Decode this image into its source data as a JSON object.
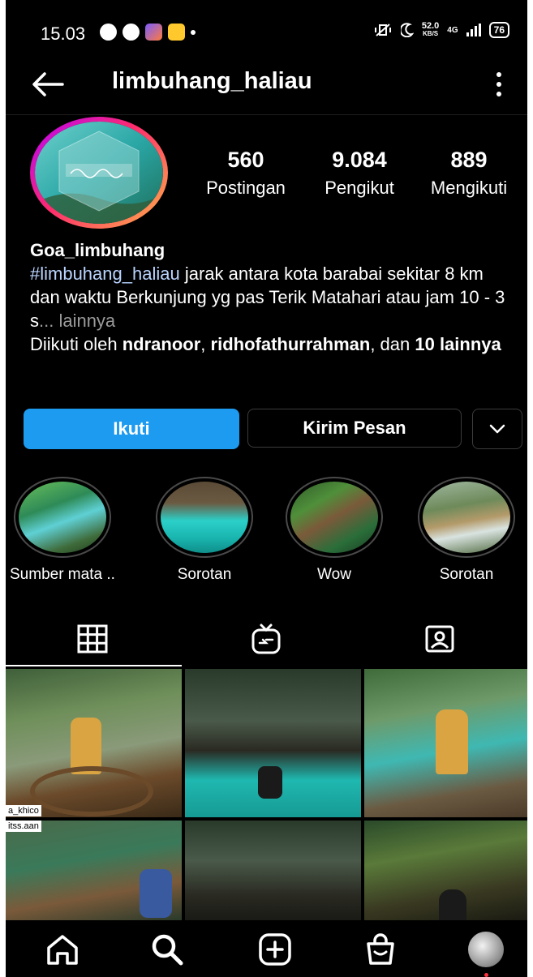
{
  "status_bar": {
    "time": "15.03",
    "network_speed": "52.0",
    "network_unit": "KB/S",
    "network_type": "4G",
    "battery": "76"
  },
  "header": {
    "username": "limbuhang_haliau"
  },
  "profile": {
    "avatar_icon": "profile-logo",
    "stats": [
      {
        "value": "560",
        "label": "Postingan"
      },
      {
        "value": "9.084",
        "label": "Pengikut"
      },
      {
        "value": "889",
        "label": "Mengikuti"
      }
    ],
    "bio": {
      "name": "Goa_limbuhang",
      "hashtag": "#limbuhang_haliau",
      "text": " jarak antara kota barabai sekitar 8 km dan waktu Berkunjung yg pas Terik Matahari atau jam 10 - 3 s",
      "more_label": "... lainnya",
      "followed_by_prefix": "Diikuti oleh ",
      "followed_by_1": "ndranoor",
      "followed_by_sep": ", ",
      "followed_by_2": "ridhofathurrahman",
      "followed_by_and": ", dan ",
      "followed_by_rest": "10 lainnya"
    }
  },
  "actions": {
    "follow_label": "Ikuti",
    "message_label": "Kirim Pesan"
  },
  "highlights": [
    {
      "label": "Sumber mata ..."
    },
    {
      "label": "Sorotan"
    },
    {
      "label": "Wow"
    },
    {
      "label": "Sorotan"
    }
  ],
  "grid": {
    "tags": [
      "a_khico",
      "itss.aan"
    ]
  },
  "colors": {
    "follow_button": "#1d9bf0",
    "background": "#000000",
    "hashtag": "#b9d4ff"
  }
}
